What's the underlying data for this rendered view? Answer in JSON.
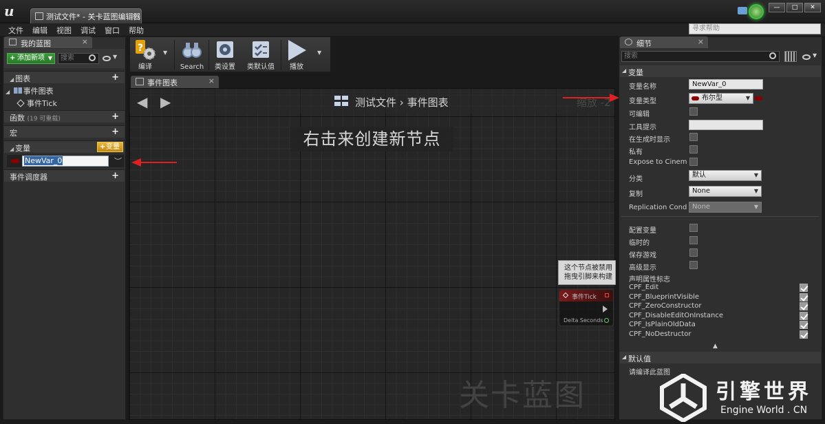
{
  "window": {
    "tab_title": "测试文件* - 关卡蓝图编辑器",
    "buttons": {
      "minimize": "—",
      "maximize": "□",
      "close": "✕"
    }
  },
  "menu": {
    "items": [
      "文件",
      "编辑",
      "视图",
      "调试",
      "窗口",
      "帮助"
    ],
    "help_search_placeholder": "寻求帮助"
  },
  "my_blueprint": {
    "tab_label": "我的蓝图",
    "add_new_label": "添加新项",
    "search_placeholder": "搜索",
    "graphs": {
      "header": "图表",
      "event_graph": "事件图表",
      "event_tick": "事件Tick"
    },
    "functions": {
      "header": "函数",
      "count_hint": "(19 可重载)"
    },
    "macros": {
      "header": "宏"
    },
    "variables": {
      "header": "变量",
      "add_label": "变量",
      "new_var_name": "NewVar_0"
    },
    "event_dispatchers": {
      "header": "事件调度器"
    }
  },
  "toolbar": {
    "compile": "编译",
    "search": "Search",
    "class_settings": "类设置",
    "class_defaults": "类默认值",
    "play": "播放"
  },
  "graph": {
    "tab_label": "事件图表",
    "breadcrumb_root": "测试文件",
    "breadcrumb_sep": "›",
    "breadcrumb_current": "事件图表",
    "zoom_label": "缩放 -2",
    "hint": "右击来创建新节点",
    "watermark": "关卡蓝图",
    "node_tooltip_line1": "这个节点被禁用",
    "node_tooltip_line2": "拖曳引脚来构建",
    "node_title": "事件Tick",
    "node_pin_label": "Delta Seconds"
  },
  "details": {
    "tab_label": "细节",
    "search_placeholder": "搜索",
    "variable_section": "变量",
    "props": {
      "var_name_label": "变量名称",
      "var_name_value": "NewVar_0",
      "var_type_label": "变量类型",
      "var_type_value": "布尔型",
      "editable": "可编辑",
      "tooltip_label": "工具提示",
      "show_on_spawn": "在生成时显示",
      "private": "私有",
      "expose_cinematics": "Expose to Cinematics",
      "category_label": "分类",
      "category_value": "默认",
      "replication_label": "复制",
      "replication_value": "None",
      "replication_condition_label": "Replication Condition",
      "replication_condition_value": "None",
      "config_variable": "配置变量",
      "transient": "临时的",
      "save_game": "保存游戏",
      "advanced_display": "高级显示",
      "property_flags": "声明属性标志"
    },
    "flags": [
      "CPF_Edit",
      "CPF_BlueprintVisible",
      "CPF_ZeroConstructor",
      "CPF_DisableEditOnInstance",
      "CPF_IsPlainOldData",
      "CPF_NoDestructor"
    ],
    "default_section": "默认值",
    "compile_hint": "请编译此蓝图"
  },
  "branding": {
    "name": "引擎世界",
    "url": "Engine World . CN"
  },
  "colors": {
    "bool_pin": "#8a0000",
    "add_new_green": "#2a7a2a",
    "add_var_orange": "#c08a10",
    "arrow_red": "#e02020",
    "unreal_badge_green": "#3fc23f"
  }
}
